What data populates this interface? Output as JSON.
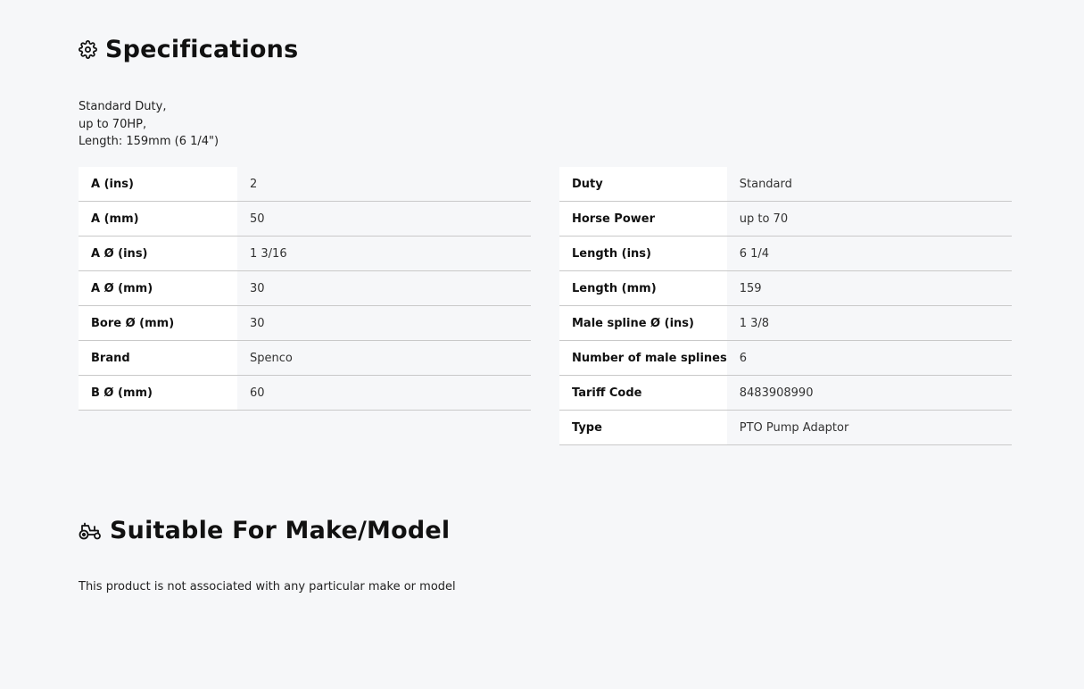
{
  "specifications": {
    "title": "Specifications",
    "icon": "gear-icon",
    "intro_lines": [
      "Standard Duty,",
      "up to 70HP,",
      "Length: 159mm (6 1/4\")"
    ],
    "left_table": [
      {
        "key": "A (ins)",
        "value": "2"
      },
      {
        "key": "A (mm)",
        "value": "50"
      },
      {
        "key": "A Ø (ins)",
        "value": "1 3/16"
      },
      {
        "key": "A Ø (mm)",
        "value": "30"
      },
      {
        "key": "Bore Ø (mm)",
        "value": "30"
      },
      {
        "key": "Brand",
        "value": "Spenco"
      },
      {
        "key": "B Ø (mm)",
        "value": "60"
      }
    ],
    "right_table": [
      {
        "key": "Duty",
        "value": "Standard"
      },
      {
        "key": "Horse Power",
        "value": "up to 70"
      },
      {
        "key": "Length (ins)",
        "value": "6 1/4"
      },
      {
        "key": "Length (mm)",
        "value": "159"
      },
      {
        "key": "Male spline Ø (ins)",
        "value": "1 3/8"
      },
      {
        "key": "Number of male splines",
        "value": "6"
      },
      {
        "key": "Tariff Code",
        "value": "8483908990"
      },
      {
        "key": "Type",
        "value": "PTO Pump Adaptor"
      }
    ]
  },
  "suitable": {
    "title": "Suitable For Make/Model",
    "icon": "tractor-icon",
    "note": "This product is not associated with any particular make or model"
  }
}
